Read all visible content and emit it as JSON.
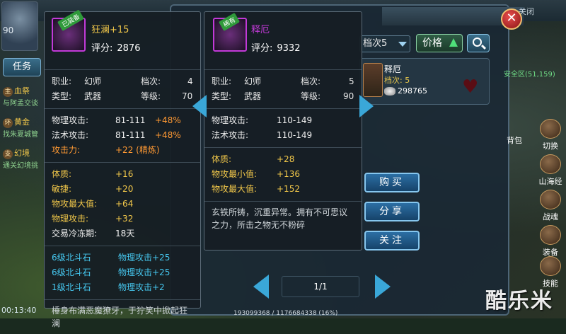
{
  "hud": {
    "level": "90",
    "task_tab": "任务",
    "quests": [
      {
        "tag": "主",
        "title": "血祭",
        "sub": "与阿孟交谈"
      },
      {
        "tag": "环",
        "title": "黄金",
        "sub": "找朱夏城管"
      },
      {
        "tag": "支",
        "title": "幻境",
        "sub": "通关幻境挑"
      }
    ],
    "time": "00:13:40",
    "exp": "193099368 / 1176684338 (16%)"
  },
  "market": {
    "close_label": "关闭",
    "close_text": "装备",
    "filter_value": "档次5",
    "price_label": "价格",
    "listing": {
      "name": "释厄",
      "grade": "档次: 5",
      "price": "298765"
    },
    "safe_zone": "安全区(51,159)",
    "buttons": {
      "buy": "购买",
      "share": "分享",
      "follow": "关注"
    },
    "pager": "1/1"
  },
  "sidebar": [
    {
      "label": "切换"
    },
    {
      "label": "山海经"
    },
    {
      "label": "战魂"
    },
    {
      "label": "装备"
    },
    {
      "label": "技能"
    }
  ],
  "bag_label": "背包",
  "equipped_tip": {
    "ribbon": "已装备",
    "name": "狂澜+15",
    "score_label": "评分:",
    "score": "2876",
    "info": {
      "job_k": "职业:",
      "job_v": "幻师",
      "grade_k": "档次:",
      "grade_v": "4",
      "type_k": "类型:",
      "type_v": "武器",
      "level_k": "等级:",
      "level_v": "70"
    },
    "base": [
      {
        "k": "物理攻击:",
        "v": "81-111",
        "bonus": "+48%"
      },
      {
        "k": "法术攻击:",
        "v": "81-111",
        "bonus": "+48%"
      },
      {
        "k": "攻击力:",
        "v": "+22 (精炼)",
        "bonus": ""
      }
    ],
    "extra": [
      {
        "k": "体质:",
        "v": "+16"
      },
      {
        "k": "敏捷:",
        "v": "+20"
      },
      {
        "k": "物攻最大值:",
        "v": "+64"
      },
      {
        "k": "物理攻击:",
        "v": "+32"
      },
      {
        "k": "交易冷冻期:",
        "v": "18天"
      }
    ],
    "gems": [
      {
        "k": "6级北斗石",
        "v": "物理攻击+25"
      },
      {
        "k": "6级北斗石",
        "v": "物理攻击+25"
      },
      {
        "k": "1级北斗石",
        "v": "物理攻击+2"
      }
    ],
    "desc": "棰身布满恶魔獠牙，于狞笑中掀起狂澜"
  },
  "compare_tip": {
    "ribbon": "稀有",
    "name": "释厄",
    "score_label": "评分:",
    "score": "9332",
    "info": {
      "job_k": "职业:",
      "job_v": "幻师",
      "grade_k": "档次:",
      "grade_v": "5",
      "type_k": "类型:",
      "type_v": "武器",
      "level_k": "等级:",
      "level_v": "90"
    },
    "base": [
      {
        "k": "物理攻击:",
        "v": "110-149"
      },
      {
        "k": "法术攻击:",
        "v": "110-149"
      }
    ],
    "extra": [
      {
        "k": "体质:",
        "v": "+28"
      },
      {
        "k": "物攻最小值:",
        "v": "+136"
      },
      {
        "k": "物攻最大值:",
        "v": "+152"
      }
    ],
    "desc": "玄铁所铸，沉重异常。拥有不可思议之力，所击之物无不粉碎"
  },
  "watermark": "酷乐米",
  "colors": {
    "gold": "#f2c84a",
    "cyan": "#46c8f0",
    "orange": "#ff9933",
    "rare_purple": "#c23ad8",
    "equipped_gold": "#f2c84a"
  }
}
